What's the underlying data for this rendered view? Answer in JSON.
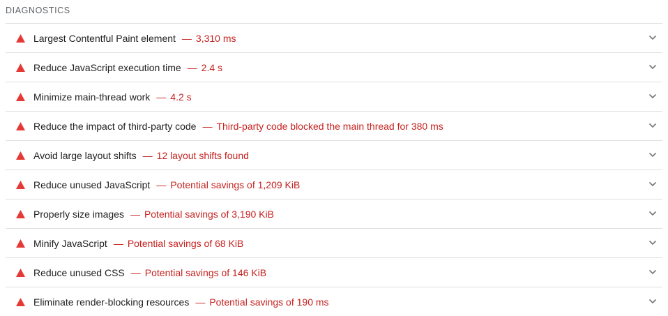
{
  "section": {
    "title": "DIAGNOSTICS"
  },
  "colors": {
    "fail": "#e53935",
    "display_text": "#c5221f",
    "divider": "#e0e0e0",
    "chevron": "#757575"
  },
  "separator": "—",
  "audits": [
    {
      "title": "Largest Contentful Paint element",
      "display": "3,310 ms",
      "status_icon": "fail-triangle-icon"
    },
    {
      "title": "Reduce JavaScript execution time",
      "display": "2.4 s",
      "status_icon": "fail-triangle-icon"
    },
    {
      "title": "Minimize main-thread work",
      "display": "4.2 s",
      "status_icon": "fail-triangle-icon"
    },
    {
      "title": "Reduce the impact of third-party code",
      "display": "Third-party code blocked the main thread for 380 ms",
      "status_icon": "fail-triangle-icon"
    },
    {
      "title": "Avoid large layout shifts",
      "display": "12 layout shifts found",
      "status_icon": "fail-triangle-icon"
    },
    {
      "title": "Reduce unused JavaScript",
      "display": "Potential savings of 1,209 KiB",
      "status_icon": "fail-triangle-icon"
    },
    {
      "title": "Properly size images",
      "display": "Potential savings of 3,190 KiB",
      "status_icon": "fail-triangle-icon"
    },
    {
      "title": "Minify JavaScript",
      "display": "Potential savings of 68 KiB",
      "status_icon": "fail-triangle-icon"
    },
    {
      "title": "Reduce unused CSS",
      "display": "Potential savings of 146 KiB",
      "status_icon": "fail-triangle-icon"
    },
    {
      "title": "Eliminate render-blocking resources",
      "display": "Potential savings of 190 ms",
      "status_icon": "fail-triangle-icon"
    }
  ]
}
